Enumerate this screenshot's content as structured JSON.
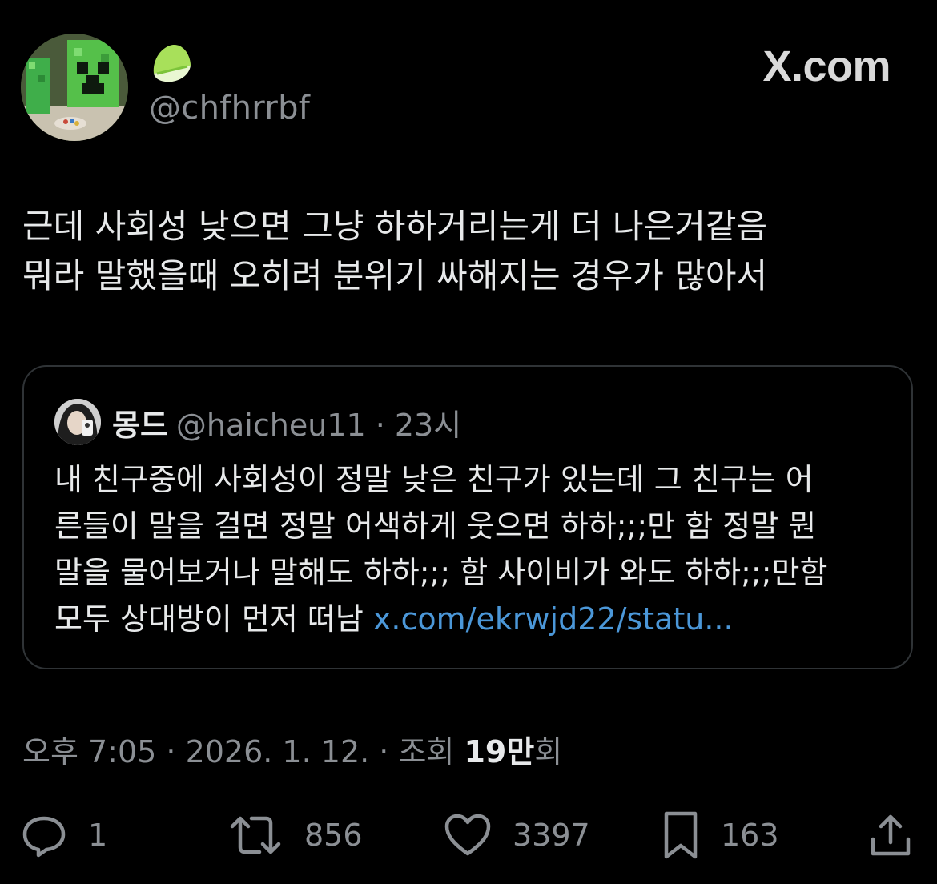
{
  "header": {
    "handle": "@chfhrrbf",
    "brand": "X.com",
    "emoji_icon": "lime-icon",
    "avatar_icon": "creeper-avatar"
  },
  "tweet": {
    "text": "근데 사회성 낮으면 그냥 하하거리는게 더 나은거같음\n뭐라 말했을때 오히려 분위기 싸해지는 경우가 많아서"
  },
  "quote": {
    "name": "몽드",
    "handle_time": "@haicheu11 · 23시",
    "text": "내 친구중에 사회성이 정말 낮은 친구가 있는데 그 친구는 어\n른들이 말을 걸면 정말 어색하게 웃으면 하하;;;만 함 정말 뭔\n말을 물어보거나 말해도 하하;;; 함 사이비가 와도 하하;;;만함\n모두 상대방이 먼저 떠남 ",
    "link": "x.com/ekrwjd22/statu..."
  },
  "meta": {
    "timestamp": "오후 7:05 · 2026. 1. 12. · 조회 ",
    "views": "19만",
    "views_suffix": "회"
  },
  "actions": {
    "reply_count": "1",
    "repost_count": "856",
    "like_count": "3397",
    "bookmark_count": "163"
  },
  "colors": {
    "background": "#000000",
    "text": "#e7e9ea",
    "secondary": "#8b8f94",
    "link": "#4b97d8",
    "border": "#2f3336"
  }
}
